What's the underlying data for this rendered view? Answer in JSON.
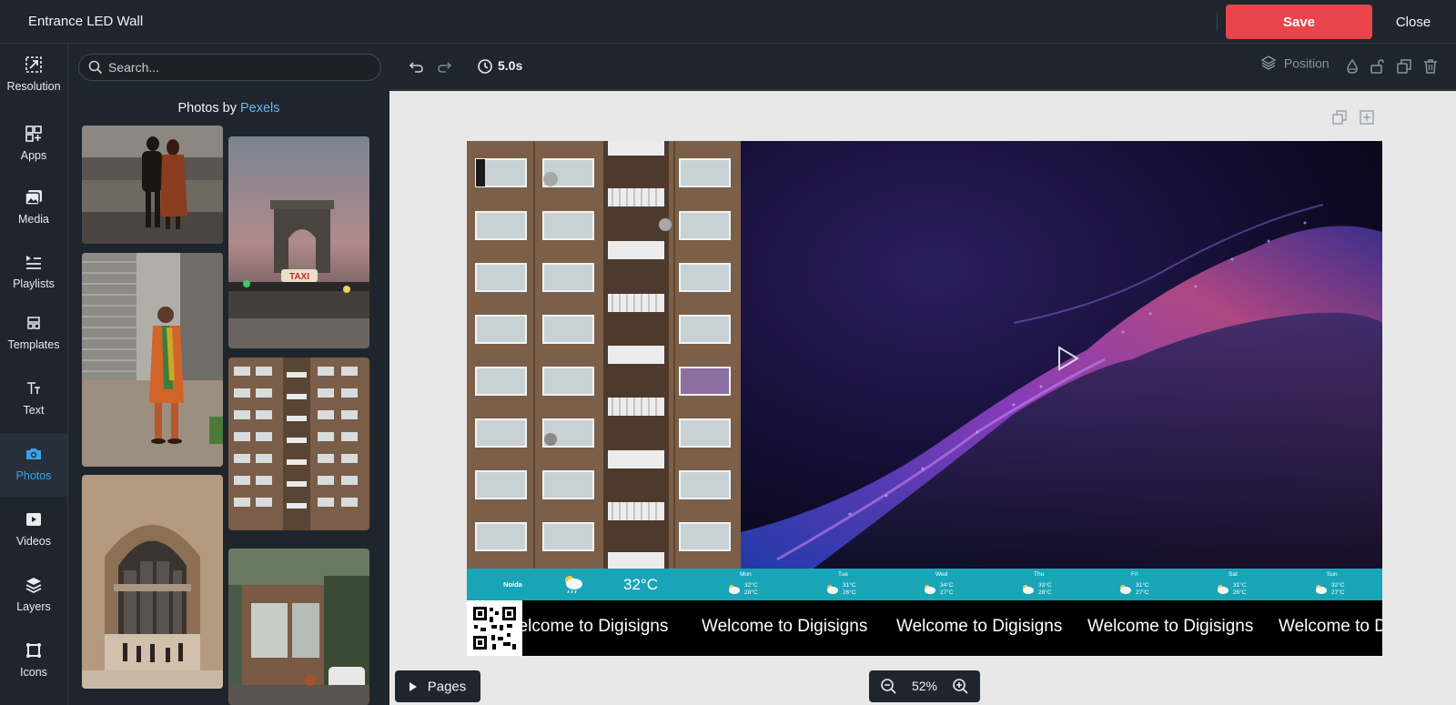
{
  "header": {
    "title": "Entrance LED Wall",
    "save_label": "Save",
    "close_label": "Close",
    "save_color": "#e9444b"
  },
  "sidebar": {
    "active_color": "#3aa3e8",
    "items": [
      {
        "label": "Resolution",
        "icon": "resolution-icon"
      },
      {
        "label": "Apps",
        "icon": "apps-icon"
      },
      {
        "label": "Media",
        "icon": "media-icon"
      },
      {
        "label": "Playlists",
        "icon": "playlists-icon"
      },
      {
        "label": "Templates",
        "icon": "templates-icon"
      },
      {
        "label": "Text",
        "icon": "text-icon"
      },
      {
        "label": "Photos",
        "icon": "camera-icon",
        "active": true
      },
      {
        "label": "Videos",
        "icon": "video-icon"
      },
      {
        "label": "Layers",
        "icon": "layers-icon"
      },
      {
        "label": "Icons",
        "icon": "icons-icon"
      }
    ]
  },
  "panel": {
    "search_placeholder": "Search...",
    "credit_prefix": "Photos by",
    "credit_link": "Pexels"
  },
  "toolbar": {
    "duration": "5.0s",
    "position_label": "Position"
  },
  "slide": {
    "weather": {
      "city": "Noida",
      "temp": "32°C",
      "days": [
        {
          "name": "Mon",
          "high": "32°C",
          "low": "28°C"
        },
        {
          "name": "Tue",
          "high": "31°C",
          "low": "26°C"
        },
        {
          "name": "Wed",
          "high": "34°C",
          "low": "27°C"
        },
        {
          "name": "Thu",
          "high": "33°C",
          "low": "28°C"
        },
        {
          "name": "Fri",
          "high": "31°C",
          "low": "27°C"
        },
        {
          "name": "Sat",
          "high": "31°C",
          "low": "26°C"
        },
        {
          "name": "Sun",
          "high": "32°C",
          "low": "27°C"
        }
      ]
    },
    "ticker": {
      "items": [
        "Welcome to Digisigns",
        "Welcome to Digisigns",
        "Welcome to Digisigns",
        "Welcome to Digisigns",
        "Welcome to Digisigns"
      ]
    }
  },
  "footer": {
    "pages_label": "Pages",
    "zoom": "52%"
  }
}
